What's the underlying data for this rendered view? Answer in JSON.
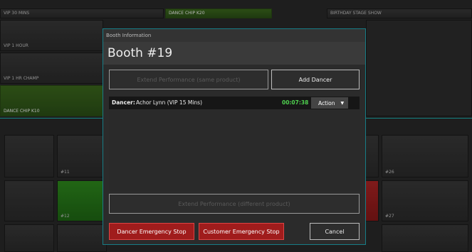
{
  "background": {
    "top_tiles": [
      {
        "name": "vip-30-mins",
        "label": "VIP 30 MINS",
        "style": "plain"
      },
      {
        "name": "dance-chip-k20",
        "label": "DANCE CHIP K20",
        "style": "green"
      },
      {
        "name": "birthday-stage-show",
        "label": "BIRTHDAY STAGE SHOW",
        "style": "plain"
      },
      {
        "name": "vip-1-hour",
        "label": "VIP 1 HOUR",
        "style": "plain"
      },
      {
        "name": "vip-1-hr-champ",
        "label": "VIP 1 HR CHAMP",
        "style": "plain"
      },
      {
        "name": "dance-chip-k10",
        "label": "DANCE CHIP K10",
        "style": "green"
      }
    ],
    "booth_tiles": [
      {
        "name": "booth-tile-11",
        "label": "#11"
      },
      {
        "name": "booth-tile-12",
        "label": "#12"
      },
      {
        "name": "booth-tile-26",
        "label": "#26"
      },
      {
        "name": "booth-tile-27",
        "label": "#27"
      }
    ],
    "colors": {
      "accent": "#1bb3b3",
      "green": "#3d6b1e",
      "bright_green": "#2f8d1e",
      "red": "#b12525"
    }
  },
  "modal": {
    "header": "Booth Information",
    "title": "Booth #19",
    "extend_same_label": "Extend Performance (same product)",
    "add_dancer_label": "Add Dancer",
    "dancer": {
      "label": "Dancer:",
      "name": "Achor Lynn (VIP 15 Mins)",
      "timer": "00:07:38",
      "action_label": "Action"
    },
    "extend_different_label": "Extend Performance (different product)",
    "dancer_stop_label": "Dancer Emergency Stop",
    "customer_stop_label": "Customer Emergency Stop",
    "cancel_label": "Cancel"
  }
}
